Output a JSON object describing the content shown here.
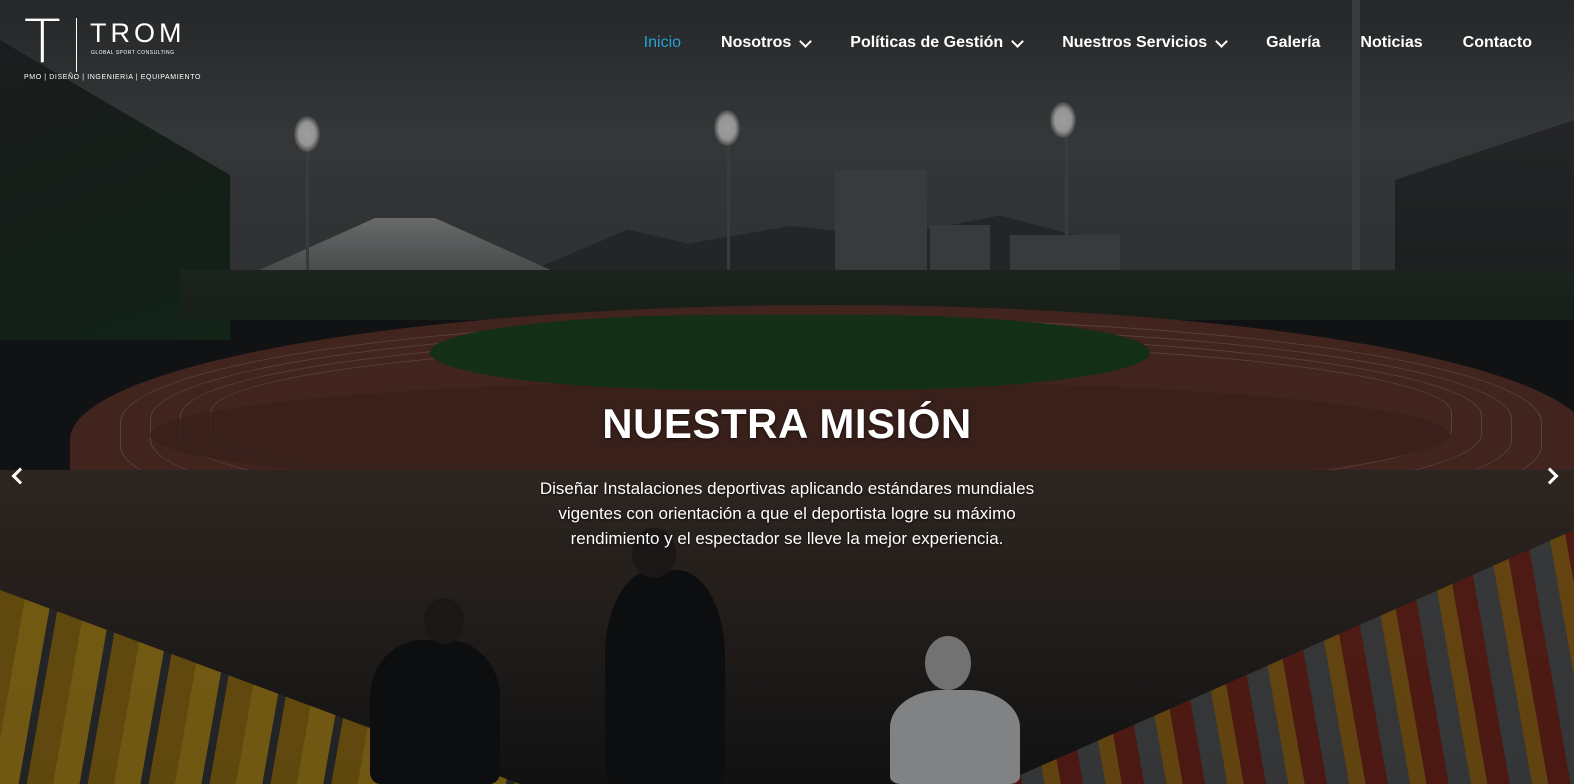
{
  "logo": {
    "letter": "T",
    "wordmark": "TROM",
    "subtitle": "GLOBAL SPORT CONSULTING",
    "tagline": "PMO | DISEÑO | INGENIERIA | EQUIPAMIENTO"
  },
  "nav": {
    "items": [
      {
        "label": "Inicio",
        "active": true,
        "has_dropdown": false
      },
      {
        "label": "Nosotros",
        "active": false,
        "has_dropdown": true
      },
      {
        "label": "Políticas de Gestión",
        "active": false,
        "has_dropdown": true
      },
      {
        "label": "Nuestros Servicios",
        "active": false,
        "has_dropdown": true
      },
      {
        "label": "Galería",
        "active": false,
        "has_dropdown": false
      },
      {
        "label": "Noticias",
        "active": false,
        "has_dropdown": false
      },
      {
        "label": "Contacto",
        "active": false,
        "has_dropdown": false
      }
    ],
    "active_color": "#23a4d6"
  },
  "hero": {
    "title": "NUESTRA MISIÓN",
    "text_lines": [
      "Diseñar Instalaciones deportivas aplicando estándares mundiales",
      "vigentes con orientación a que el deportista logre su máximo",
      "rendimiento y el espectador se lleve la mejor experiencia."
    ],
    "prev_icon": "chevron-left-icon",
    "next_icon": "chevron-right-icon"
  }
}
